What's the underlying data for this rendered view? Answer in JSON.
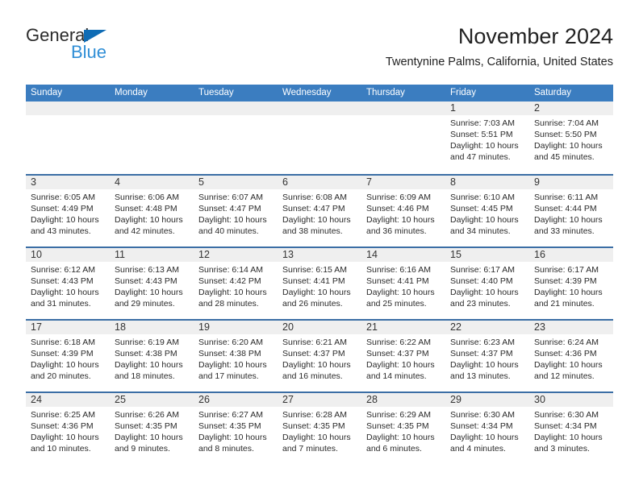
{
  "brand": {
    "general": "General",
    "blue": "Blue",
    "triangle_color": "#0f6cb5",
    "blue_color": "#2f8ed6"
  },
  "header": {
    "title": "November 2024",
    "subtitle": "Twentynine Palms, California, United States",
    "header_bg": "#3b7dc0",
    "row_divider": "#3b6ea5",
    "daynum_band": "#efefef"
  },
  "weekdays": [
    "Sunday",
    "Monday",
    "Tuesday",
    "Wednesday",
    "Thursday",
    "Friday",
    "Saturday"
  ],
  "labels": {
    "sunrise_prefix": "Sunrise:",
    "sunset_prefix": "Sunset:",
    "daylight_prefix": "Daylight:"
  },
  "weeks": [
    [
      {
        "empty": true
      },
      {
        "empty": true
      },
      {
        "empty": true
      },
      {
        "empty": true
      },
      {
        "empty": true
      },
      {
        "day": "1",
        "sunrise": "Sunrise: 7:03 AM",
        "sunset": "Sunset: 5:51 PM",
        "daylight1": "Daylight: 10 hours",
        "daylight2": "and 47 minutes."
      },
      {
        "day": "2",
        "sunrise": "Sunrise: 7:04 AM",
        "sunset": "Sunset: 5:50 PM",
        "daylight1": "Daylight: 10 hours",
        "daylight2": "and 45 minutes."
      }
    ],
    [
      {
        "day": "3",
        "sunrise": "Sunrise: 6:05 AM",
        "sunset": "Sunset: 4:49 PM",
        "daylight1": "Daylight: 10 hours",
        "daylight2": "and 43 minutes."
      },
      {
        "day": "4",
        "sunrise": "Sunrise: 6:06 AM",
        "sunset": "Sunset: 4:48 PM",
        "daylight1": "Daylight: 10 hours",
        "daylight2": "and 42 minutes."
      },
      {
        "day": "5",
        "sunrise": "Sunrise: 6:07 AM",
        "sunset": "Sunset: 4:47 PM",
        "daylight1": "Daylight: 10 hours",
        "daylight2": "and 40 minutes."
      },
      {
        "day": "6",
        "sunrise": "Sunrise: 6:08 AM",
        "sunset": "Sunset: 4:47 PM",
        "daylight1": "Daylight: 10 hours",
        "daylight2": "and 38 minutes."
      },
      {
        "day": "7",
        "sunrise": "Sunrise: 6:09 AM",
        "sunset": "Sunset: 4:46 PM",
        "daylight1": "Daylight: 10 hours",
        "daylight2": "and 36 minutes."
      },
      {
        "day": "8",
        "sunrise": "Sunrise: 6:10 AM",
        "sunset": "Sunset: 4:45 PM",
        "daylight1": "Daylight: 10 hours",
        "daylight2": "and 34 minutes."
      },
      {
        "day": "9",
        "sunrise": "Sunrise: 6:11 AM",
        "sunset": "Sunset: 4:44 PM",
        "daylight1": "Daylight: 10 hours",
        "daylight2": "and 33 minutes."
      }
    ],
    [
      {
        "day": "10",
        "sunrise": "Sunrise: 6:12 AM",
        "sunset": "Sunset: 4:43 PM",
        "daylight1": "Daylight: 10 hours",
        "daylight2": "and 31 minutes."
      },
      {
        "day": "11",
        "sunrise": "Sunrise: 6:13 AM",
        "sunset": "Sunset: 4:43 PM",
        "daylight1": "Daylight: 10 hours",
        "daylight2": "and 29 minutes."
      },
      {
        "day": "12",
        "sunrise": "Sunrise: 6:14 AM",
        "sunset": "Sunset: 4:42 PM",
        "daylight1": "Daylight: 10 hours",
        "daylight2": "and 28 minutes."
      },
      {
        "day": "13",
        "sunrise": "Sunrise: 6:15 AM",
        "sunset": "Sunset: 4:41 PM",
        "daylight1": "Daylight: 10 hours",
        "daylight2": "and 26 minutes."
      },
      {
        "day": "14",
        "sunrise": "Sunrise: 6:16 AM",
        "sunset": "Sunset: 4:41 PM",
        "daylight1": "Daylight: 10 hours",
        "daylight2": "and 25 minutes."
      },
      {
        "day": "15",
        "sunrise": "Sunrise: 6:17 AM",
        "sunset": "Sunset: 4:40 PM",
        "daylight1": "Daylight: 10 hours",
        "daylight2": "and 23 minutes."
      },
      {
        "day": "16",
        "sunrise": "Sunrise: 6:17 AM",
        "sunset": "Sunset: 4:39 PM",
        "daylight1": "Daylight: 10 hours",
        "daylight2": "and 21 minutes."
      }
    ],
    [
      {
        "day": "17",
        "sunrise": "Sunrise: 6:18 AM",
        "sunset": "Sunset: 4:39 PM",
        "daylight1": "Daylight: 10 hours",
        "daylight2": "and 20 minutes."
      },
      {
        "day": "18",
        "sunrise": "Sunrise: 6:19 AM",
        "sunset": "Sunset: 4:38 PM",
        "daylight1": "Daylight: 10 hours",
        "daylight2": "and 18 minutes."
      },
      {
        "day": "19",
        "sunrise": "Sunrise: 6:20 AM",
        "sunset": "Sunset: 4:38 PM",
        "daylight1": "Daylight: 10 hours",
        "daylight2": "and 17 minutes."
      },
      {
        "day": "20",
        "sunrise": "Sunrise: 6:21 AM",
        "sunset": "Sunset: 4:37 PM",
        "daylight1": "Daylight: 10 hours",
        "daylight2": "and 16 minutes."
      },
      {
        "day": "21",
        "sunrise": "Sunrise: 6:22 AM",
        "sunset": "Sunset: 4:37 PM",
        "daylight1": "Daylight: 10 hours",
        "daylight2": "and 14 minutes."
      },
      {
        "day": "22",
        "sunrise": "Sunrise: 6:23 AM",
        "sunset": "Sunset: 4:37 PM",
        "daylight1": "Daylight: 10 hours",
        "daylight2": "and 13 minutes."
      },
      {
        "day": "23",
        "sunrise": "Sunrise: 6:24 AM",
        "sunset": "Sunset: 4:36 PM",
        "daylight1": "Daylight: 10 hours",
        "daylight2": "and 12 minutes."
      }
    ],
    [
      {
        "day": "24",
        "sunrise": "Sunrise: 6:25 AM",
        "sunset": "Sunset: 4:36 PM",
        "daylight1": "Daylight: 10 hours",
        "daylight2": "and 10 minutes."
      },
      {
        "day": "25",
        "sunrise": "Sunrise: 6:26 AM",
        "sunset": "Sunset: 4:35 PM",
        "daylight1": "Daylight: 10 hours",
        "daylight2": "and 9 minutes."
      },
      {
        "day": "26",
        "sunrise": "Sunrise: 6:27 AM",
        "sunset": "Sunset: 4:35 PM",
        "daylight1": "Daylight: 10 hours",
        "daylight2": "and 8 minutes."
      },
      {
        "day": "27",
        "sunrise": "Sunrise: 6:28 AM",
        "sunset": "Sunset: 4:35 PM",
        "daylight1": "Daylight: 10 hours",
        "daylight2": "and 7 minutes."
      },
      {
        "day": "28",
        "sunrise": "Sunrise: 6:29 AM",
        "sunset": "Sunset: 4:35 PM",
        "daylight1": "Daylight: 10 hours",
        "daylight2": "and 6 minutes."
      },
      {
        "day": "29",
        "sunrise": "Sunrise: 6:30 AM",
        "sunset": "Sunset: 4:34 PM",
        "daylight1": "Daylight: 10 hours",
        "daylight2": "and 4 minutes."
      },
      {
        "day": "30",
        "sunrise": "Sunrise: 6:30 AM",
        "sunset": "Sunset: 4:34 PM",
        "daylight1": "Daylight: 10 hours",
        "daylight2": "and 3 minutes."
      }
    ]
  ]
}
